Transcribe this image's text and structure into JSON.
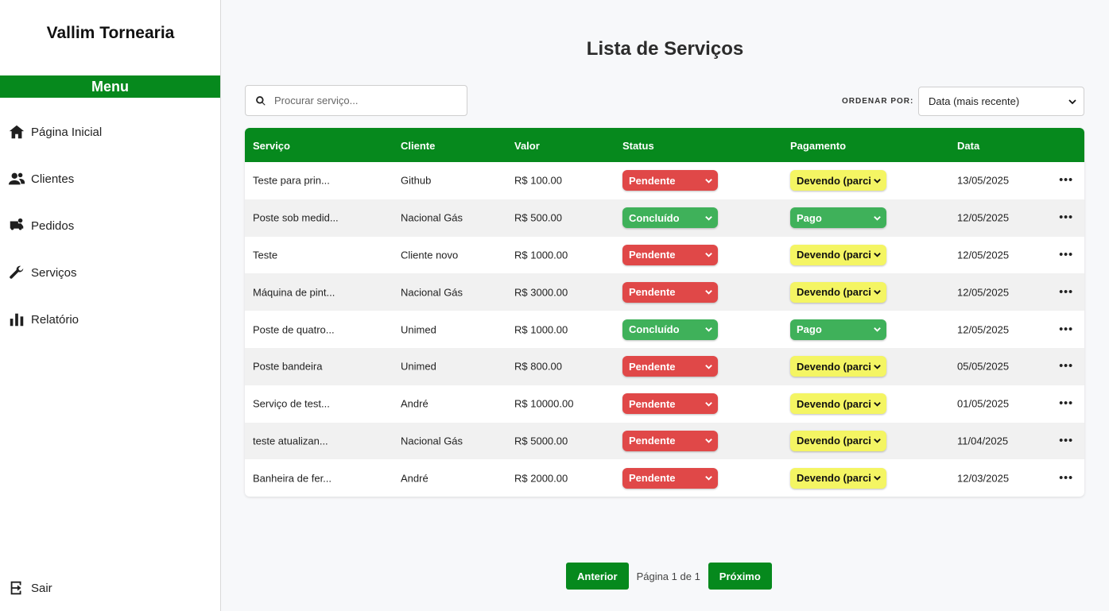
{
  "app": {
    "brand": "Vallim Tornearia",
    "menu_label": "Menu"
  },
  "nav": [
    {
      "label": "Página Inicial",
      "icon": "home-icon"
    },
    {
      "label": "Clientes",
      "icon": "users-icon"
    },
    {
      "label": "Pedidos",
      "icon": "orders-icon"
    },
    {
      "label": "Serviços",
      "icon": "wrench-icon"
    },
    {
      "label": "Relatório",
      "icon": "chart-icon"
    }
  ],
  "logout_label": "Sair",
  "page": {
    "title": "Lista de Serviços"
  },
  "search": {
    "placeholder": "Procurar serviço..."
  },
  "sort": {
    "label": "ORDENAR POR:",
    "selected": "Data (mais recente)"
  },
  "table": {
    "headers": {
      "service": "Serviço",
      "client": "Cliente",
      "value": "Valor",
      "status": "Status",
      "payment": "Pagamento",
      "date": "Data"
    },
    "rows": [
      {
        "service": "Teste para prin...",
        "client": "Github",
        "value": "R$ 100.00",
        "status": "Pendente",
        "payment": "Devendo (parci",
        "date": "13/05/2025"
      },
      {
        "service": "Poste sob medid...",
        "client": "Nacional Gás",
        "value": "R$ 500.00",
        "status": "Concluído",
        "payment": "Pago",
        "date": "12/05/2025"
      },
      {
        "service": "Teste",
        "client": "Cliente novo",
        "value": "R$ 1000.00",
        "status": "Pendente",
        "payment": "Devendo (parci",
        "date": "12/05/2025"
      },
      {
        "service": "Máquina de pint...",
        "client": "Nacional Gás",
        "value": "R$ 3000.00",
        "status": "Pendente",
        "payment": "Devendo (parci",
        "date": "12/05/2025"
      },
      {
        "service": "Poste de quatro...",
        "client": "Unimed",
        "value": "R$ 1000.00",
        "status": "Concluído",
        "payment": "Pago",
        "date": "12/05/2025"
      },
      {
        "service": "Poste bandeira",
        "client": "Unimed",
        "value": "R$ 800.00",
        "status": "Pendente",
        "payment": "Devendo (parci",
        "date": "05/05/2025"
      },
      {
        "service": "Serviço de test...",
        "client": "André",
        "value": "R$ 10000.00",
        "status": "Pendente",
        "payment": "Devendo (parci",
        "date": "01/05/2025"
      },
      {
        "service": "teste atualizan...",
        "client": "Nacional Gás",
        "value": "R$ 5000.00",
        "status": "Pendente",
        "payment": "Devendo (parci",
        "date": "11/04/2025"
      },
      {
        "service": "Banheira de fer...",
        "client": "André",
        "value": "R$ 2000.00",
        "status": "Pendente",
        "payment": "Devendo (parci",
        "date": "12/03/2025"
      }
    ]
  },
  "colors": {
    "brand_green": "#06891d",
    "status_pending": "#e04848",
    "status_done": "#3fb15a",
    "payment_owing": "#f4f563",
    "payment_paid": "#3fb15a"
  },
  "pagination": {
    "prev_label": "Anterior",
    "info": "Página 1 de 1",
    "next_label": "Próximo"
  }
}
